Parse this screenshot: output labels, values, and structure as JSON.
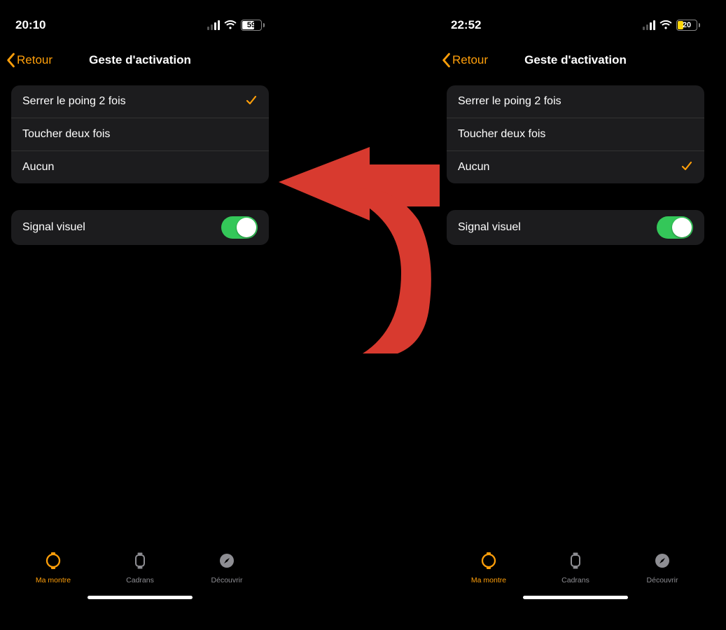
{
  "colors": {
    "accent": "#ff9f0a",
    "toggle_on": "#34c759",
    "low_power": "#ffd60a"
  },
  "screens": {
    "left": {
      "status": {
        "time": "20:10",
        "battery_pct": "59",
        "battery_color": "white"
      },
      "nav": {
        "back": "Retour",
        "title": "Geste d'activation"
      },
      "options": [
        {
          "label": "Serrer le poing 2 fois",
          "checked": true
        },
        {
          "label": "Toucher deux fois",
          "checked": false
        },
        {
          "label": "Aucun",
          "checked": false
        }
      ],
      "visual": {
        "label": "Signal visuel",
        "on": true
      },
      "tabs": [
        {
          "label": "Ma montre",
          "icon": "watch",
          "active": true
        },
        {
          "label": "Cadrans",
          "icon": "faces",
          "active": false
        },
        {
          "label": "Découvrir",
          "icon": "compass",
          "active": false
        }
      ]
    },
    "right": {
      "status": {
        "time": "22:52",
        "battery_pct": "20",
        "battery_color": "yellow"
      },
      "nav": {
        "back": "Retour",
        "title": "Geste d'activation"
      },
      "options": [
        {
          "label": "Serrer le poing 2 fois",
          "checked": false
        },
        {
          "label": "Toucher deux fois",
          "checked": false
        },
        {
          "label": "Aucun",
          "checked": true
        }
      ],
      "visual": {
        "label": "Signal visuel",
        "on": true
      },
      "tabs": [
        {
          "label": "Ma montre",
          "icon": "watch",
          "active": true
        },
        {
          "label": "Cadrans",
          "icon": "faces",
          "active": false
        },
        {
          "label": "Découvrir",
          "icon": "compass",
          "active": false
        }
      ]
    }
  }
}
